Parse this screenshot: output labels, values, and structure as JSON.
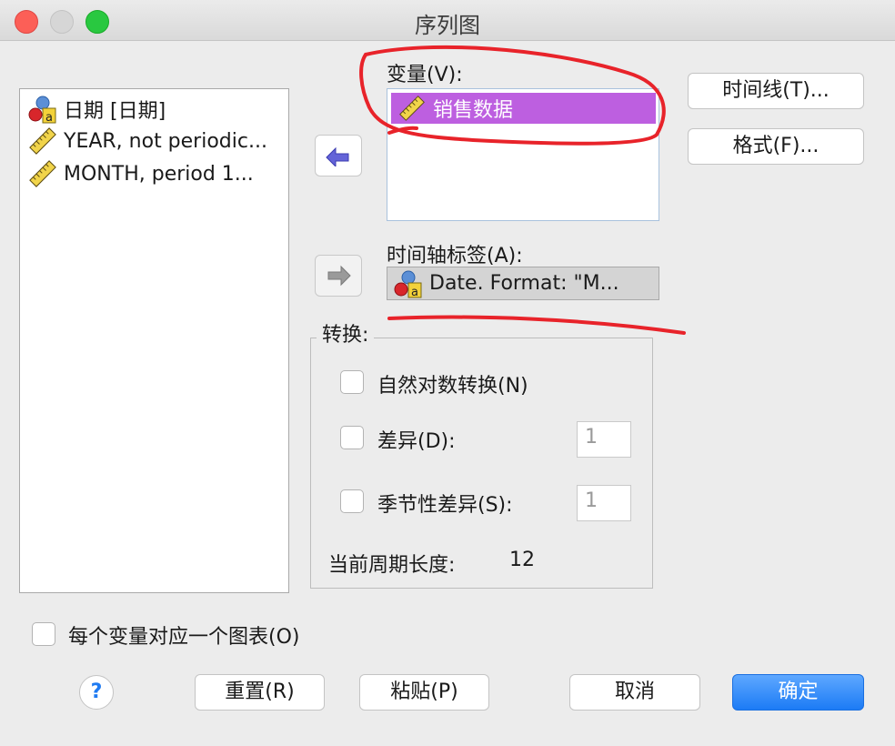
{
  "window": {
    "title": "序列图"
  },
  "source_list": {
    "items": [
      {
        "label": "日期 [日期]",
        "icon": "nominal-date-icon"
      },
      {
        "label": "YEAR, not periodic...",
        "icon": "scale-ruler-icon"
      },
      {
        "label": "MONTH, period 1...",
        "icon": "scale-ruler-icon"
      }
    ]
  },
  "variables": {
    "label": "变量(V):",
    "selected": "销售数据"
  },
  "time_axis": {
    "label": "时间轴标签(A):",
    "value": "Date.  Format:  \"M..."
  },
  "transform": {
    "title": "转换:",
    "natural_log_label": "自然对数转换(N)",
    "natural_log_checked": false,
    "difference_label": "差异(D):",
    "difference_checked": false,
    "difference_value": "1",
    "seasonal_label": "季节性差异(S):",
    "seasonal_checked": false,
    "seasonal_value": "1",
    "period_label": "当前周期长度:",
    "period_value": "12"
  },
  "side_buttons": {
    "time_lines": "时间线(T)...",
    "format": "格式(F)..."
  },
  "one_chart": {
    "label": "每个变量对应一个图表(O)",
    "checked": false
  },
  "buttons": {
    "help": "?",
    "reset": "重置(R)",
    "paste": "粘贴(P)",
    "cancel": "取消",
    "ok": "确定"
  },
  "colors": {
    "selection": "#bd5fe0",
    "ok_button": "#1c7bf5",
    "annotation": "#e8232a"
  }
}
